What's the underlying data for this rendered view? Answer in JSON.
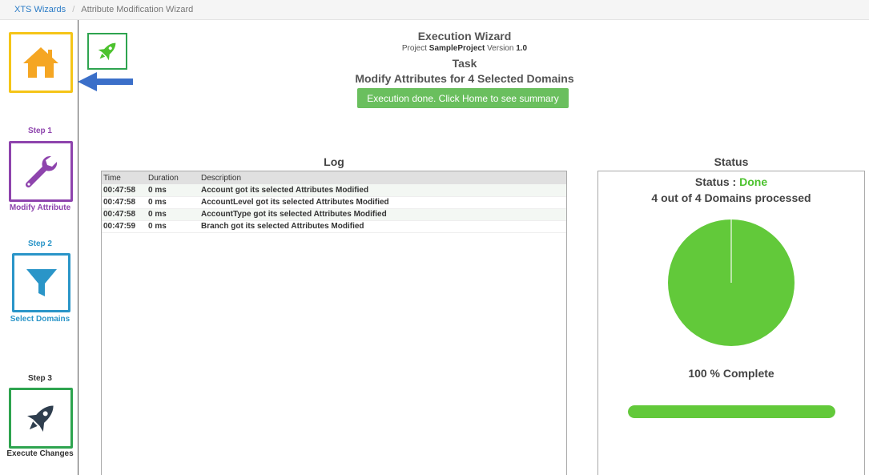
{
  "breadcrumb": {
    "root": "XTS Wizards",
    "current": "Attribute Modification Wizard"
  },
  "sidebar": {
    "home_icon": "home-icon",
    "steps": [
      {
        "step": "Step 1",
        "caption": "Modify Attribute",
        "icon": "wrench-icon",
        "color": "#8e44ad"
      },
      {
        "step": "Step 2",
        "caption": "Select Domains",
        "icon": "filter-icon",
        "color": "#2a95c8"
      },
      {
        "step": "Step 3",
        "caption": "Execute Changes",
        "icon": "rocket-icon",
        "color": "#2ea44f"
      }
    ]
  },
  "header": {
    "title": "Execution Wizard",
    "project_prefix": "Project",
    "project_name": "SampleProject",
    "version_prefix": "Version",
    "version": "1.0",
    "task_label": "Task",
    "task_title": "Modify Attributes for 4 Selected Domains",
    "done_button": "Execution done. Click Home to see summary"
  },
  "log": {
    "title": "Log",
    "columns": [
      "Time",
      "Duration",
      "Description"
    ],
    "rows": [
      {
        "time": "00:47:58",
        "duration": "0 ms",
        "description": "Account got its selected Attributes Modified"
      },
      {
        "time": "00:47:58",
        "duration": "0 ms",
        "description": "AccountLevel got its selected Attributes Modified"
      },
      {
        "time": "00:47:58",
        "duration": "0 ms",
        "description": "AccountType got its selected Attributes Modified"
      },
      {
        "time": "00:47:59",
        "duration": "0 ms",
        "description": "Branch got its selected Attributes Modified"
      }
    ]
  },
  "status": {
    "title": "Status",
    "label": "Status :",
    "value": "Done",
    "processed": "4 out of 4 Domains processed",
    "complete_text": "100 % Complete",
    "progress_percent": 100,
    "colors": {
      "done": "#4cc22e",
      "pie": "#62c93a"
    }
  }
}
